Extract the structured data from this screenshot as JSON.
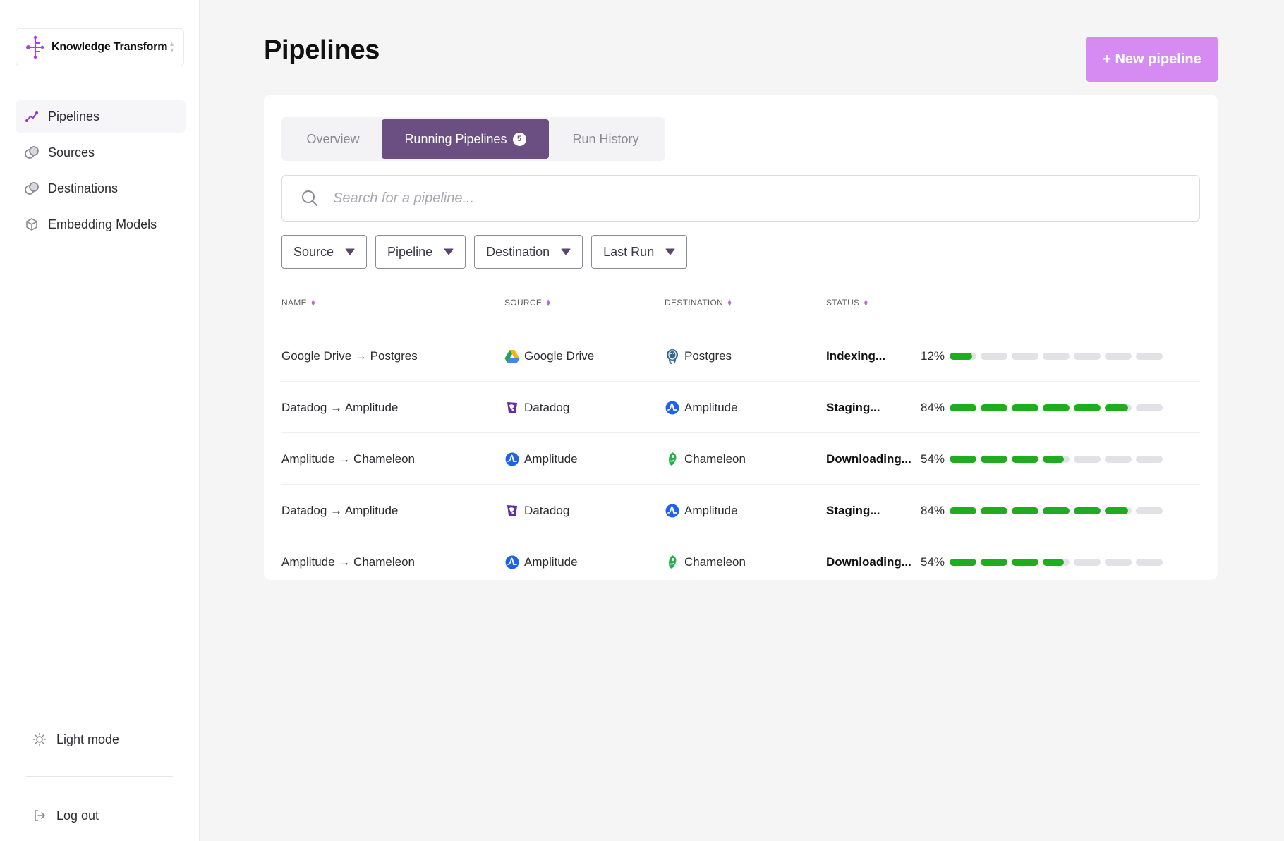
{
  "app": {
    "workspace_name": "Knowledge Transform"
  },
  "sidebar": {
    "items": [
      {
        "label": "Pipelines",
        "icon": "pipeline-icon",
        "active": true
      },
      {
        "label": "Sources",
        "icon": "sources-icon",
        "active": false
      },
      {
        "label": "Destinations",
        "icon": "destinations-icon",
        "active": false
      },
      {
        "label": "Embedding Models",
        "icon": "cube-icon",
        "active": false
      }
    ],
    "light_mode_label": "Light mode",
    "logout_label": "Log out"
  },
  "header": {
    "title": "Pipelines",
    "new_button_label": "+ New pipeline"
  },
  "tabs": [
    {
      "label": "Overview",
      "active": false
    },
    {
      "label": "Running Pipelines",
      "active": true,
      "badge": "5"
    },
    {
      "label": "Run History",
      "active": false
    }
  ],
  "search": {
    "placeholder": "Search for a pipeline..."
  },
  "filters": [
    "Source",
    "Pipeline",
    "Destination",
    "Last Run"
  ],
  "table": {
    "columns": [
      "NAME",
      "SOURCE",
      "DESTINATION",
      "STATUS"
    ],
    "rows": [
      {
        "name": "Google Drive → Postgres",
        "source": "Google Drive",
        "source_icon": "google-drive-icon",
        "destination": "Postgres",
        "destination_icon": "postgres-icon",
        "status": "Indexing...",
        "percent_label": "12%",
        "progress": 0.12
      },
      {
        "name": "Datadog → Amplitude",
        "source": "Datadog",
        "source_icon": "datadog-icon",
        "destination": "Amplitude",
        "destination_icon": "amplitude-icon",
        "status": "Staging...",
        "percent_label": "84%",
        "progress": 0.84
      },
      {
        "name": "Amplitude → Chameleon",
        "source": "Amplitude",
        "source_icon": "amplitude-icon",
        "destination": "Chameleon",
        "destination_icon": "chameleon-icon",
        "status": "Downloading...",
        "percent_label": "54%",
        "progress": 0.54
      },
      {
        "name": "Datadog → Amplitude",
        "source": "Datadog",
        "source_icon": "datadog-icon",
        "destination": "Amplitude",
        "destination_icon": "amplitude-icon",
        "status": "Staging...",
        "percent_label": "84%",
        "progress": 0.84
      },
      {
        "name": "Amplitude → Chameleon",
        "source": "Amplitude",
        "source_icon": "amplitude-icon",
        "destination": "Chameleon",
        "destination_icon": "chameleon-icon",
        "status": "Downloading...",
        "percent_label": "54%",
        "progress": 0.54
      }
    ]
  },
  "colors": {
    "accent": "#d58bf2",
    "active_tab": "#6b4e82",
    "progress_fill": "#1fad1f",
    "progress_track": "#e2e2e6"
  }
}
